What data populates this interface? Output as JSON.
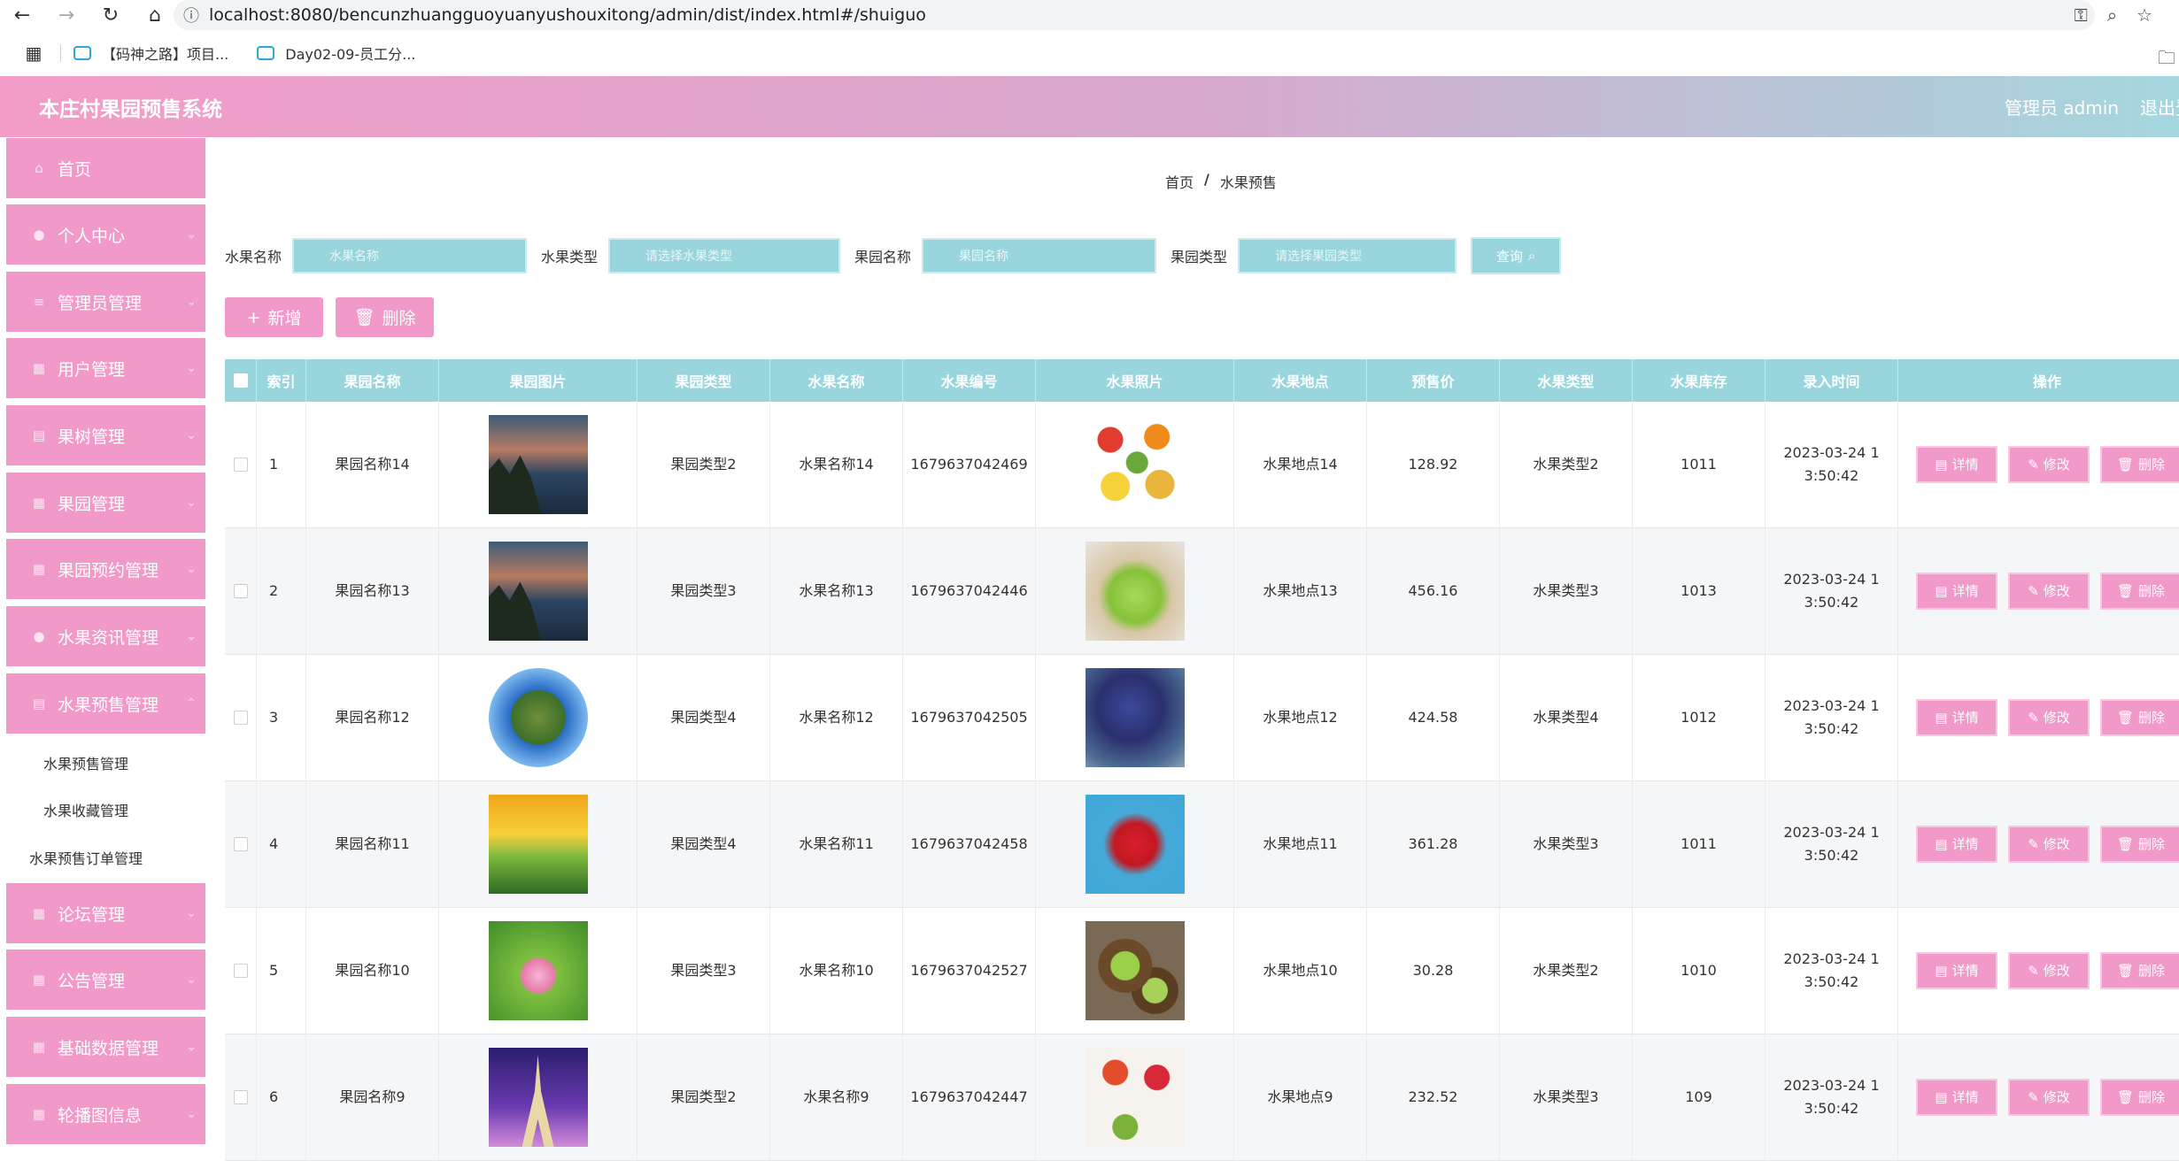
{
  "browser": {
    "url": "localhost:8080/bencunzhuangguoyuanyushouxitong/admin/dist/index.html#/shuiguo",
    "bookmarks": [
      "【码神之路】项目...",
      "Day02-09-员工分..."
    ]
  },
  "header": {
    "title": "本庄村果园预售系统",
    "user": "管理员 admin",
    "logout": "退出登录"
  },
  "sidebar": {
    "items": [
      {
        "label": "首页",
        "icon": "home-icon"
      },
      {
        "label": "个人中心",
        "icon": "user-icon"
      },
      {
        "label": "管理员管理",
        "icon": "list-icon"
      },
      {
        "label": "用户管理",
        "icon": "grid-icon"
      },
      {
        "label": "果树管理",
        "icon": "document-icon"
      },
      {
        "label": "果园管理",
        "icon": "grid-icon"
      },
      {
        "label": "果园预约管理",
        "icon": "grid-icon"
      },
      {
        "label": "水果资讯管理",
        "icon": "user-icon"
      },
      {
        "label": "水果预售管理",
        "icon": "document-icon"
      },
      {
        "label": "论坛管理",
        "icon": "grid-icon"
      },
      {
        "label": "公告管理",
        "icon": "grid-icon"
      },
      {
        "label": "基础数据管理",
        "icon": "grid-icon"
      },
      {
        "label": "轮播图信息",
        "icon": "grid-icon"
      }
    ],
    "subitems": [
      "水果预售管理",
      "水果收藏管理",
      "水果预售订单管理"
    ]
  },
  "breadcrumb": {
    "home": "首页",
    "separator": "/",
    "current": "水果预售"
  },
  "search": {
    "fruit_name_label": "水果名称",
    "fruit_name_placeholder": "水果名称",
    "fruit_type_label": "水果类型",
    "fruit_type_placeholder": "请选择水果类型",
    "orchard_name_label": "果园名称",
    "orchard_name_placeholder": "果园名称",
    "orchard_type_label": "果园类型",
    "orchard_type_placeholder": "请选择果园类型",
    "query_button": "查询"
  },
  "actions": {
    "add": "新增",
    "delete": "删除"
  },
  "table": {
    "columns": [
      "索引",
      "果园名称",
      "果园图片",
      "果园类型",
      "水果名称",
      "水果编号",
      "水果照片",
      "水果地点",
      "预售价",
      "水果类型",
      "水果库存",
      "录入时间",
      "操作"
    ],
    "op_labels": {
      "detail": "详情",
      "edit": "修改",
      "delete": "删除"
    },
    "rows": [
      {
        "index": "1",
        "orchard_name": "果园名称14",
        "orchard_img": "img-sunset",
        "orchard_type": "果园类型2",
        "fruit_name": "水果名称14",
        "fruit_no": "1679637042469",
        "fruit_img": "img-fruits",
        "place": "水果地点14",
        "price": "128.92",
        "fruit_type": "水果类型2",
        "stock": "1011",
        "time": "2023-03-24 13:50:42"
      },
      {
        "index": "2",
        "orchard_name": "果园名称13",
        "orchard_img": "img-sunset",
        "orchard_type": "果园类型3",
        "fruit_name": "水果名称13",
        "fruit_no": "1679637042446",
        "fruit_img": "img-grapes",
        "place": "水果地点13",
        "price": "456.16",
        "fruit_type": "水果类型3",
        "stock": "1013",
        "time": "2023-03-24 13:50:42"
      },
      {
        "index": "3",
        "orchard_name": "果园名称12",
        "orchard_img": "img-planet",
        "orchard_type": "果园类型4",
        "fruit_name": "水果名称12",
        "fruit_no": "1679637042505",
        "fruit_img": "img-blue",
        "place": "水果地点12",
        "price": "424.58",
        "fruit_type": "水果类型4",
        "stock": "1012",
        "time": "2023-03-24 13:50:42"
      },
      {
        "index": "4",
        "orchard_name": "果园名称11",
        "orchard_img": "img-sun",
        "orchard_type": "果园类型4",
        "fruit_name": "水果名称11",
        "fruit_no": "1679637042458",
        "fruit_img": "img-straw",
        "place": "水果地点11",
        "price": "361.28",
        "fruit_type": "水果类型3",
        "stock": "1011",
        "time": "2023-03-24 13:50:42"
      },
      {
        "index": "5",
        "orchard_name": "果园名称10",
        "orchard_img": "img-lotus",
        "orchard_type": "果园类型3",
        "fruit_name": "水果名称10",
        "fruit_no": "1679637042527",
        "fruit_img": "img-kiwi",
        "place": "水果地点10",
        "price": "30.28",
        "fruit_type": "水果类型2",
        "stock": "1010",
        "time": "2023-03-24 13:50:42"
      },
      {
        "index": "6",
        "orchard_name": "果园名称9",
        "orchard_img": "img-tower",
        "orchard_type": "果园类型2",
        "fruit_name": "水果名称9",
        "fruit_no": "1679637042447",
        "fruit_img": "img-mix",
        "place": "水果地点9",
        "price": "232.52",
        "fruit_type": "水果类型3",
        "stock": "109",
        "time": "2023-03-24 13:50:42"
      }
    ]
  }
}
